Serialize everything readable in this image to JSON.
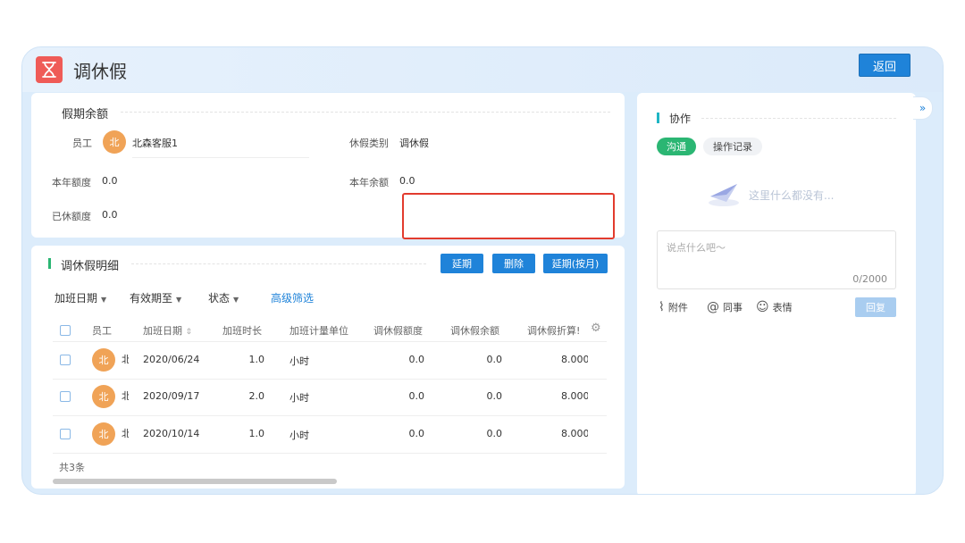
{
  "app": {
    "title": "调休假",
    "back_label": "返回"
  },
  "balance": {
    "title": "假期余额",
    "employee_label": "员工",
    "employee_avatar": "北",
    "employee_name": "北森客服1",
    "leave_type_label": "休假类别",
    "leave_type_value": "调休假",
    "year_quota_label": "本年额度",
    "year_quota_value": "0.0",
    "year_remaining_label": "本年余额",
    "year_remaining_value": "0.0",
    "used_label": "已休额度",
    "used_value": "0.0"
  },
  "detail": {
    "title": "调休假明细",
    "buttons": {
      "extend": "延期",
      "delete": "删除",
      "extend_month": "延期(按月)"
    },
    "filters": {
      "overtime_date": "加班日期",
      "valid_until": "有效期至",
      "status": "状态",
      "advanced": "高级筛选"
    },
    "columns": [
      "员工",
      "加班日期",
      "加班时长",
      "加班计量单位",
      "调休假额度",
      "调休假余额",
      "调休假折算!"
    ],
    "rows": [
      {
        "avatar": "北",
        "name_frag": "北",
        "date": "2020/06/24",
        "hours": "1.0",
        "unit": "小时",
        "quota": "0.0",
        "remaining": "0.0",
        "converted": "8.000"
      },
      {
        "avatar": "北",
        "name_frag": "北",
        "date": "2020/09/17",
        "hours": "2.0",
        "unit": "小时",
        "quota": "0.0",
        "remaining": "0.0",
        "converted": "8.000"
      },
      {
        "avatar": "北",
        "name_frag": "北",
        "date": "2020/10/14",
        "hours": "1.0",
        "unit": "小时",
        "quota": "0.0",
        "remaining": "0.0",
        "converted": "8.000"
      }
    ],
    "total": "共3条"
  },
  "collab": {
    "title": "协作",
    "tab_chat": "沟通",
    "tab_log": "操作记录",
    "empty": "这里什么都没有...",
    "placeholder": "说点什么吧～",
    "counter": "0/2000",
    "tool_attach": "附件",
    "tool_mention": "同事",
    "tool_emoji": "表情",
    "reply": "回复"
  },
  "colors": {
    "primary": "#1f83d9",
    "accent_green": "#2bb673",
    "highlight": "#e23b2e",
    "avatar": "#f0a357",
    "icon_red": "#ef5b57"
  }
}
